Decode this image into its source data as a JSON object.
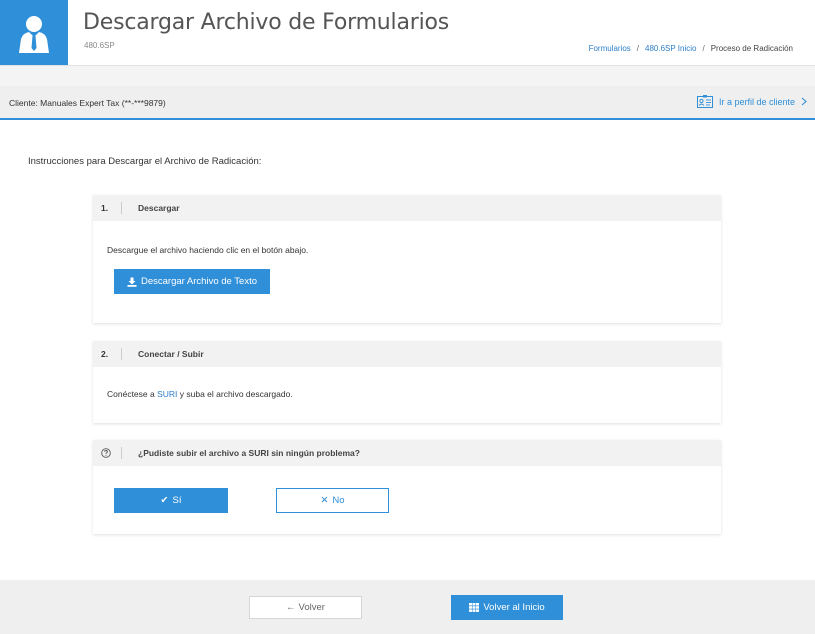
{
  "header": {
    "title": "Descargar Archivo de Formularios",
    "subtitle": "480.6SP",
    "breadcrumb": {
      "item1": "Formularios",
      "item2": "480.6SP Inicio",
      "current": "Proceso de Radicación",
      "separator": "/"
    }
  },
  "client": {
    "label": "Cliente: Manuales Expert Tax (**-***9879)",
    "profile_link": "Ir a perfil de cliente"
  },
  "instructions": "Instrucciones para Descargar el Archivo de Radicación:",
  "step1": {
    "number": "1.",
    "title": "Descargar",
    "text": "Descargue el archivo haciendo clic en el botón abajo.",
    "button": "Descargar Archivo de Texto"
  },
  "step2": {
    "number": "2.",
    "title": "Conectar / Subir",
    "text_before": "Conéctese a ",
    "link": "SURI",
    "text_after": " y suba el archivo descargado."
  },
  "question": {
    "title": "¿Pudiste subir el archivo a SURI sin ningún problema?",
    "yes_label": "Sí",
    "no_label": "No"
  },
  "footer": {
    "back_label": "Volver",
    "home_label": "Volver al Inicio"
  },
  "colors": {
    "primary": "#2f8fd8",
    "link": "#2f7fc9"
  }
}
